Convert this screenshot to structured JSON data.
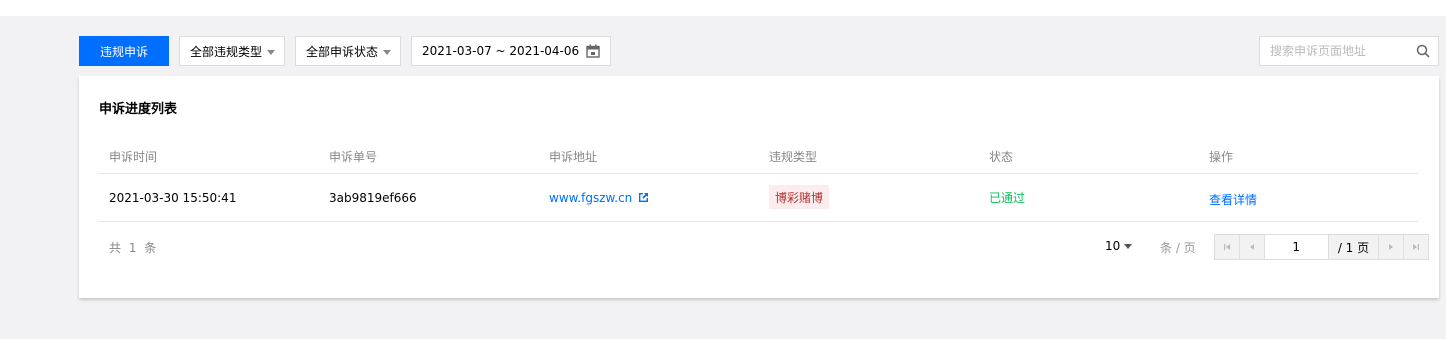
{
  "toolbar": {
    "appeal_button": "违规申诉",
    "type_select": "全部违规类型",
    "status_select": "全部申诉状态",
    "date_range": "2021-03-07 ~ 2021-04-06",
    "search_placeholder": "搜索申诉页面地址"
  },
  "card": {
    "title": "申诉进度列表",
    "columns": [
      "申诉时间",
      "申诉单号",
      "申诉地址",
      "违规类型",
      "状态",
      "操作"
    ],
    "rows": [
      {
        "time": "2021-03-30 15:50:41",
        "ticket": "3ab9819ef666",
        "url": "www.fgszw.cn",
        "violation": "博彩赌博",
        "status": "已通过",
        "action": "查看详情"
      }
    ]
  },
  "pagination": {
    "total": "共 1 条",
    "page_size": "10",
    "per_page": "条 / 页",
    "current_page": "1",
    "total_pages": "/ 1 页"
  },
  "colors": {
    "primary": "#006eff",
    "success": "#0abf5b",
    "danger_text": "#b43537",
    "danger_bg": "#fcecec"
  },
  "icons": {
    "calendar": "calendar-icon",
    "search": "search-icon",
    "external": "external-link-icon",
    "first": "first-page-icon",
    "prev": "prev-page-icon",
    "next": "next-page-icon",
    "last": "last-page-icon"
  }
}
